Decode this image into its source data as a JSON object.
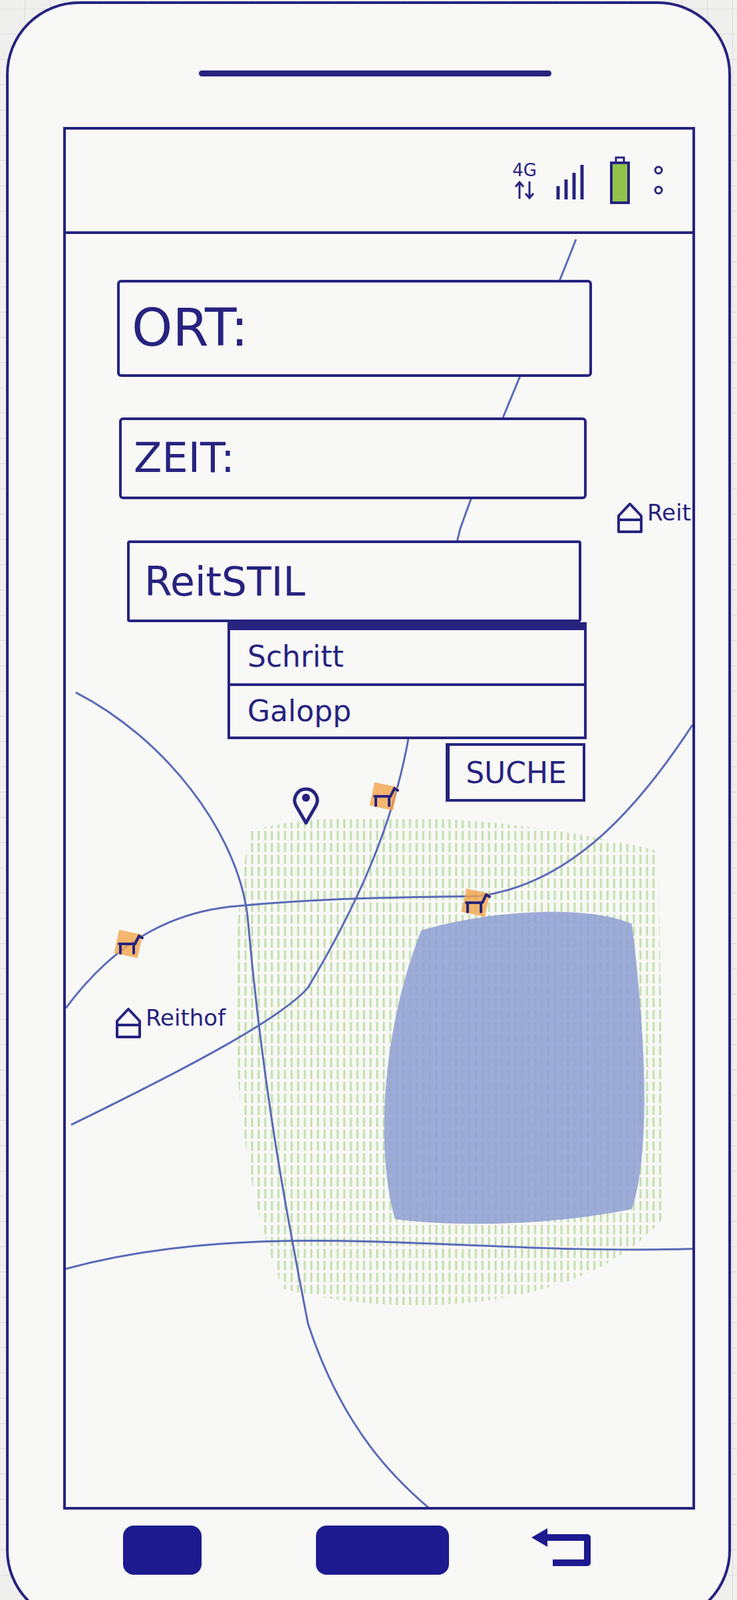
{
  "status_bar": {
    "network": "4G"
  },
  "form": {
    "fields": [
      {
        "label": "ORT:"
      },
      {
        "label": "ZEIT:"
      }
    ],
    "riding_style": {
      "label": "ReitSTIL",
      "expanded": true,
      "options": [
        {
          "label": "Schritt",
          "selected": false
        },
        {
          "label": "Galopp",
          "selected": false
        }
      ]
    },
    "search_button": "SUCHE"
  },
  "map": {
    "places": [
      {
        "label": "Reit"
      },
      {
        "label": "Reithof"
      }
    ]
  }
}
